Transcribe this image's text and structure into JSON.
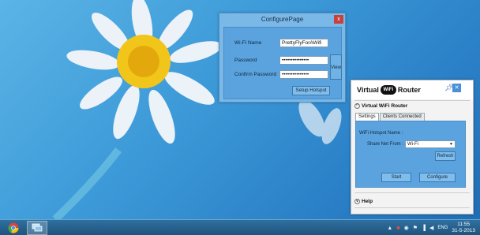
{
  "configure_dialog": {
    "title": "ConfigurePage",
    "close_label": "x",
    "wifi_name_label": "Wi-Fi Name",
    "wifi_name_value": "PrettyFlyForAWifi",
    "password_label": "Password",
    "password_value": "•••••••••••••••",
    "confirm_label": "Confirm Password",
    "confirm_value": "•••••••••••••••",
    "view_label": "View",
    "setup_button": "Setup Hotspot"
  },
  "router": {
    "title_before": "Virtual",
    "logo_text": "WiFi",
    "title_after": "Router",
    "section_label": "Virtual WiFi Router",
    "tabs": [
      {
        "label": "Settings",
        "active": true
      },
      {
        "label": "Clients Connected",
        "active": false
      }
    ],
    "hotspot_name_label": "WiFi Hotspot Name :",
    "share_from_label": "Share Net From :",
    "share_from_value": "Wi-Fi",
    "refresh_label": "Refresh",
    "start_label": "Start",
    "configure_label": "Configure",
    "help_label": "Help",
    "collapse_symbol": "^",
    "expand_symbol": "v"
  },
  "taskbar": {
    "language": "ENG",
    "time": "11:55",
    "date": "31-5-2013"
  },
  "colors": {
    "desktop": "#3d9ad8",
    "dialog_body": "#5aa3df",
    "taskbar": "#1f557f"
  }
}
